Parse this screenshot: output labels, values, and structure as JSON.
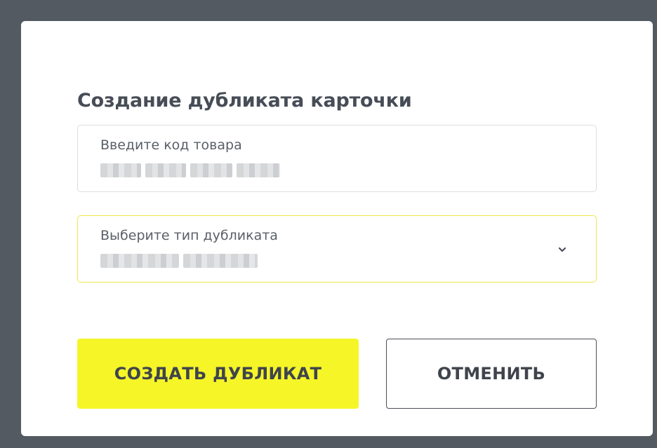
{
  "dialog": {
    "title": "Создание дубликата карточки",
    "product_code_field": {
      "label": "Введите код товара",
      "value": ""
    },
    "duplicate_type_field": {
      "label": "Выберите тип дубликата",
      "value": "",
      "icon": "chevron-down-icon"
    },
    "create_button_label": "СОЗДАТЬ ДУБЛИКАТ",
    "cancel_button_label": "ОТМЕНИТЬ"
  },
  "colors": {
    "backdrop": "#545a62",
    "primary_button": "#f5f528",
    "active_field_border": "#eee84a",
    "text": "#474d56"
  }
}
